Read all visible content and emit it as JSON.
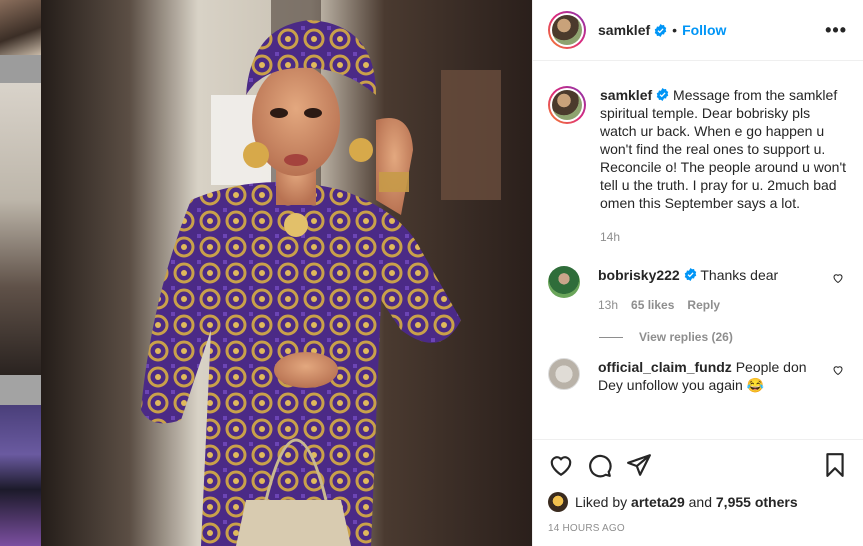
{
  "post": {
    "username": "samklef",
    "separator": "•",
    "follow_label": "Follow",
    "more_label": "•••",
    "caption": {
      "username": "samklef",
      "text": "Message from the samklef spiritual temple. Dear bobrisky pls watch ur back. When e go happen u won't find the real ones to support u. Reconcile o! The people around u won't tell u the truth. I pray for u. 2much bad omen this September says a lot.",
      "time": "14h"
    },
    "comments": [
      {
        "username": "bobrisky222",
        "verified": true,
        "text": "Thanks dear",
        "time": "13h",
        "likes": "65 likes",
        "reply_label": "Reply",
        "view_replies": "View replies (26)"
      },
      {
        "username": "official_claim_fundz",
        "verified": false,
        "text": "People don Dey unfollow you again 😂"
      }
    ],
    "liked_by_prefix": "Liked by",
    "liked_by_user": "arteta29",
    "liked_by_and": "and",
    "liked_by_others": "7,955 others",
    "time_ago": "14 HOURS AGO"
  },
  "colors": {
    "accent": "#0095f6",
    "verified": "#0095f6",
    "muted": "#8e8e8e",
    "text": "#262626"
  },
  "icons": [
    "verified-badge-icon",
    "more-options-icon",
    "heart-icon",
    "comment-icon",
    "share-icon",
    "bookmark-icon"
  ]
}
